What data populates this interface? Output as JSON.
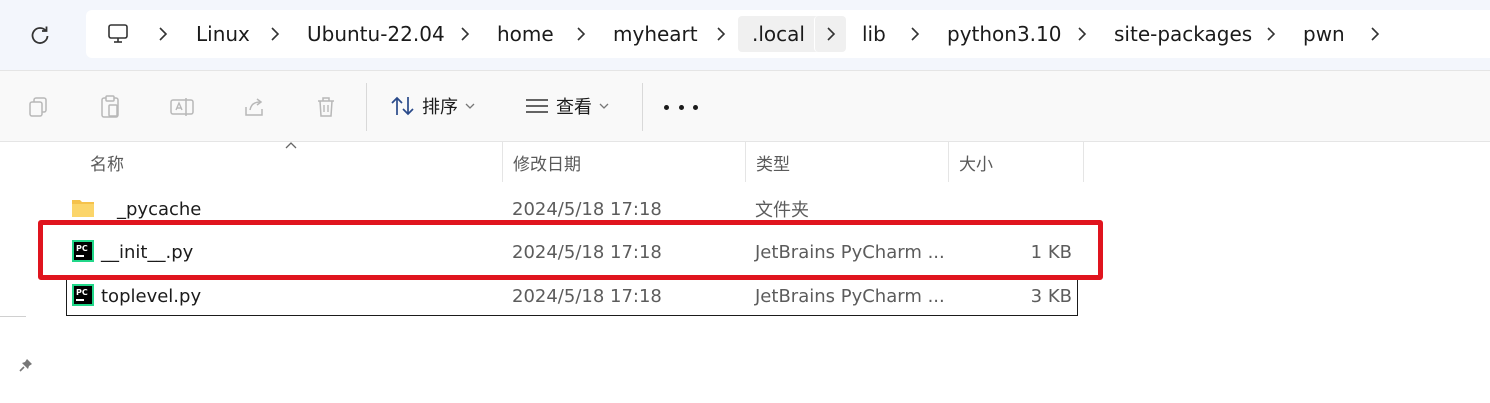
{
  "address_bar": {
    "breadcrumbs": [
      "Linux",
      "Ubuntu-22.04",
      "home",
      "myheart",
      ".local",
      "lib",
      "python3.10",
      "site-packages",
      "pwn"
    ],
    "highlighted": ".local",
    "icons": {
      "refresh": "refresh-icon",
      "root": "computer-icon",
      "separator": "chevron-right-icon"
    }
  },
  "toolbar": {
    "sort_label": "排序",
    "view_label": "查看",
    "icons": [
      "copy-icon",
      "paste-icon",
      "rename-icon",
      "share-icon",
      "delete-icon",
      "sort-icon",
      "view-icon",
      "more-icon"
    ]
  },
  "columns": {
    "name": "名称",
    "modified": "修改日期",
    "type": "类型",
    "size": "大小"
  },
  "files": [
    {
      "name": "__pycache__",
      "display_name": "_pycache",
      "modified": "2024/5/18 17:18",
      "type": "文件夹",
      "size": "",
      "icon": "folder-icon"
    },
    {
      "name": "__init__.py",
      "display_name": "__init__.py",
      "modified": "2024/5/18 17:18",
      "type": "JetBrains PyCharm ...",
      "size": "1 KB",
      "icon": "pycharm-file-icon"
    },
    {
      "name": "toplevel.py",
      "display_name": "toplevel.py",
      "modified": "2024/5/18 17:18",
      "type": "JetBrains PyCharm ...",
      "size": "3 KB",
      "icon": "pycharm-file-icon"
    }
  ],
  "colors": {
    "highlight_box": "#e0141e",
    "folder": "#f5c24c",
    "pycharm_green": "#21d789"
  }
}
